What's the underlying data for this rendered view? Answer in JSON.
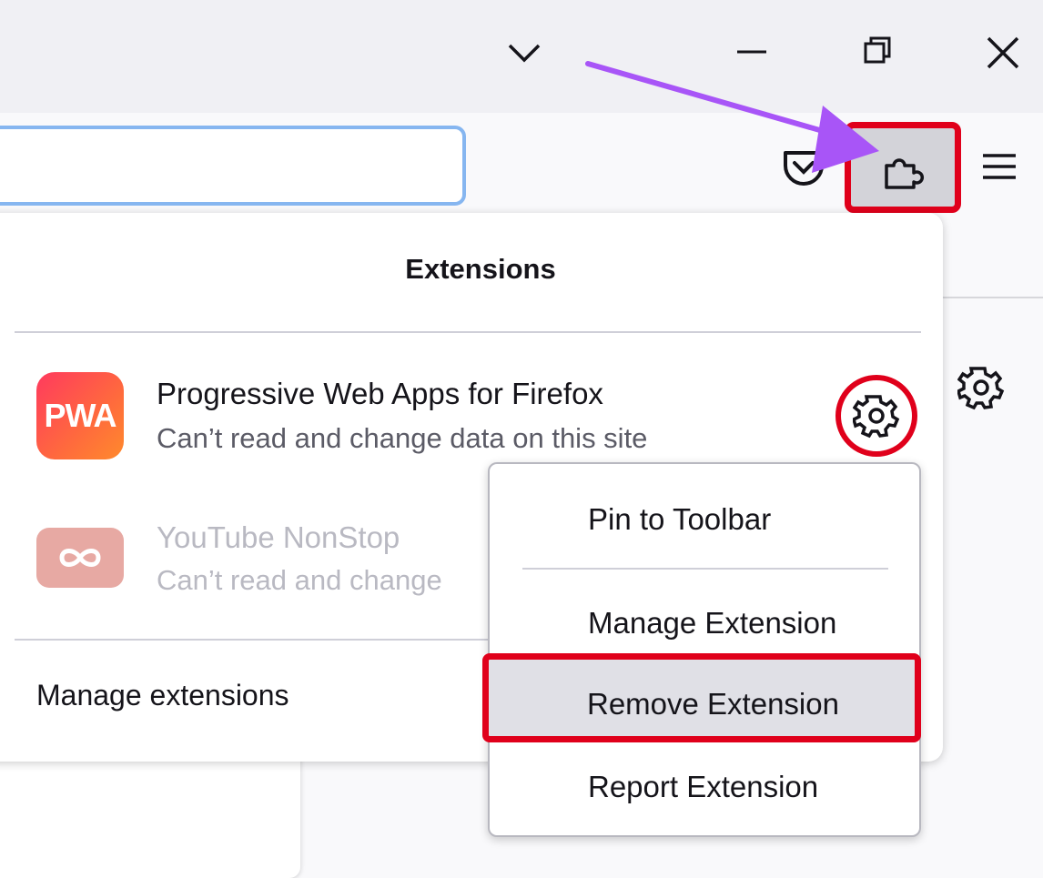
{
  "panel": {
    "title": "Extensions",
    "manage_link": "Manage extensions"
  },
  "extensions": [
    {
      "name": "Progressive Web Apps for Firefox",
      "status": "Can’t read and change data on this site",
      "icon_text": "PWA",
      "icon_color": "#ff4f4f"
    },
    {
      "name": "YouTube NonStop",
      "status": "Can’t read and change",
      "icon_color": "#e7a9a3"
    }
  ],
  "context_menu": {
    "items": [
      "Pin to Toolbar",
      "Manage Extension",
      "Remove Extension",
      "Report Extension"
    ]
  },
  "icons": {
    "titlebar": [
      "chevron-down-icon",
      "minimize-icon",
      "restore-icon",
      "close-icon"
    ],
    "toolbar": [
      "pocket-icon",
      "extensions-puzzle-icon",
      "menu-hamburger-icon"
    ],
    "page": [
      "gear-icon"
    ]
  },
  "colors": {
    "highlight_red": "#e0001b",
    "annotation_arrow": "#a855f7",
    "url_focus_border": "#86b6f0"
  }
}
